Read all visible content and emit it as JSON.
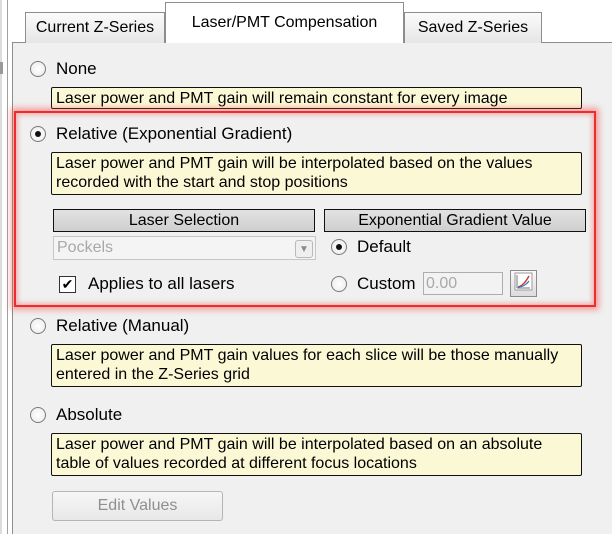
{
  "tabs": [
    {
      "label": "Current Z-Series"
    },
    {
      "label": "Laser/PMT Compensation"
    },
    {
      "label": "Saved Z-Series"
    }
  ],
  "modes": {
    "none": {
      "label": "None",
      "description": "Laser power and PMT gain will remain constant for every image",
      "selected": false
    },
    "relative_exponential": {
      "label": "Relative (Exponential Gradient)",
      "description": "Laser power and PMT gain will be interpolated based on the values recorded with the start and stop positions",
      "selected": true,
      "laser_selection": {
        "header": "Laser Selection",
        "selected_value": "Pockels",
        "applies_to_all_label": "Applies to all lasers",
        "applies_to_all_checked": true
      },
      "gradient": {
        "header": "Exponential Gradient Value",
        "default_label": "Default",
        "default_selected": true,
        "custom_label": "Custom",
        "custom_value": "0.00",
        "custom_selected": false
      }
    },
    "relative_manual": {
      "label": "Relative (Manual)",
      "description": "Laser power and PMT gain values for each slice will be those manually entered in the Z-Series grid",
      "selected": false
    },
    "absolute": {
      "label": "Absolute",
      "description": "Laser power and PMT gain will be interpolated based on an absolute table of values recorded at different focus locations",
      "selected": false,
      "edit_button": "Edit Values"
    }
  },
  "colors": {
    "highlight": "#ef2b2b",
    "description_background": "#fbf8d6"
  },
  "icons": {
    "select_arrow": "chevron-down-icon",
    "gradient_button": "curve-graph-icon",
    "checkmark": "check-icon"
  }
}
